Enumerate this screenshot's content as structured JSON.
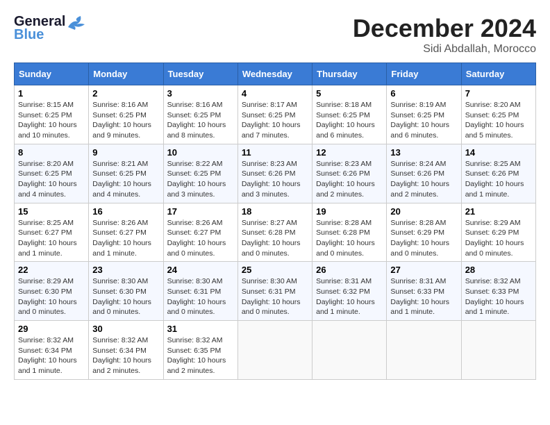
{
  "header": {
    "logo": {
      "general": "General",
      "blue": "Blue"
    },
    "title": "December 2024",
    "location": "Sidi Abdallah, Morocco"
  },
  "days_of_week": [
    "Sunday",
    "Monday",
    "Tuesday",
    "Wednesday",
    "Thursday",
    "Friday",
    "Saturday"
  ],
  "weeks": [
    [
      {
        "day": "1",
        "sunrise": "8:15 AM",
        "sunset": "6:25 PM",
        "daylight": "10 hours and 10 minutes."
      },
      {
        "day": "2",
        "sunrise": "8:16 AM",
        "sunset": "6:25 PM",
        "daylight": "10 hours and 9 minutes."
      },
      {
        "day": "3",
        "sunrise": "8:16 AM",
        "sunset": "6:25 PM",
        "daylight": "10 hours and 8 minutes."
      },
      {
        "day": "4",
        "sunrise": "8:17 AM",
        "sunset": "6:25 PM",
        "daylight": "10 hours and 7 minutes."
      },
      {
        "day": "5",
        "sunrise": "8:18 AM",
        "sunset": "6:25 PM",
        "daylight": "10 hours and 6 minutes."
      },
      {
        "day": "6",
        "sunrise": "8:19 AM",
        "sunset": "6:25 PM",
        "daylight": "10 hours and 6 minutes."
      },
      {
        "day": "7",
        "sunrise": "8:20 AM",
        "sunset": "6:25 PM",
        "daylight": "10 hours and 5 minutes."
      }
    ],
    [
      {
        "day": "8",
        "sunrise": "8:20 AM",
        "sunset": "6:25 PM",
        "daylight": "10 hours and 4 minutes."
      },
      {
        "day": "9",
        "sunrise": "8:21 AM",
        "sunset": "6:25 PM",
        "daylight": "10 hours and 4 minutes."
      },
      {
        "day": "10",
        "sunrise": "8:22 AM",
        "sunset": "6:25 PM",
        "daylight": "10 hours and 3 minutes."
      },
      {
        "day": "11",
        "sunrise": "8:23 AM",
        "sunset": "6:26 PM",
        "daylight": "10 hours and 3 minutes."
      },
      {
        "day": "12",
        "sunrise": "8:23 AM",
        "sunset": "6:26 PM",
        "daylight": "10 hours and 2 minutes."
      },
      {
        "day": "13",
        "sunrise": "8:24 AM",
        "sunset": "6:26 PM",
        "daylight": "10 hours and 2 minutes."
      },
      {
        "day": "14",
        "sunrise": "8:25 AM",
        "sunset": "6:26 PM",
        "daylight": "10 hours and 1 minute."
      }
    ],
    [
      {
        "day": "15",
        "sunrise": "8:25 AM",
        "sunset": "6:27 PM",
        "daylight": "10 hours and 1 minute."
      },
      {
        "day": "16",
        "sunrise": "8:26 AM",
        "sunset": "6:27 PM",
        "daylight": "10 hours and 1 minute."
      },
      {
        "day": "17",
        "sunrise": "8:26 AM",
        "sunset": "6:27 PM",
        "daylight": "10 hours and 0 minutes."
      },
      {
        "day": "18",
        "sunrise": "8:27 AM",
        "sunset": "6:28 PM",
        "daylight": "10 hours and 0 minutes."
      },
      {
        "day": "19",
        "sunrise": "8:28 AM",
        "sunset": "6:28 PM",
        "daylight": "10 hours and 0 minutes."
      },
      {
        "day": "20",
        "sunrise": "8:28 AM",
        "sunset": "6:29 PM",
        "daylight": "10 hours and 0 minutes."
      },
      {
        "day": "21",
        "sunrise": "8:29 AM",
        "sunset": "6:29 PM",
        "daylight": "10 hours and 0 minutes."
      }
    ],
    [
      {
        "day": "22",
        "sunrise": "8:29 AM",
        "sunset": "6:30 PM",
        "daylight": "10 hours and 0 minutes."
      },
      {
        "day": "23",
        "sunrise": "8:30 AM",
        "sunset": "6:30 PM",
        "daylight": "10 hours and 0 minutes."
      },
      {
        "day": "24",
        "sunrise": "8:30 AM",
        "sunset": "6:31 PM",
        "daylight": "10 hours and 0 minutes."
      },
      {
        "day": "25",
        "sunrise": "8:30 AM",
        "sunset": "6:31 PM",
        "daylight": "10 hours and 0 minutes."
      },
      {
        "day": "26",
        "sunrise": "8:31 AM",
        "sunset": "6:32 PM",
        "daylight": "10 hours and 1 minute."
      },
      {
        "day": "27",
        "sunrise": "8:31 AM",
        "sunset": "6:33 PM",
        "daylight": "10 hours and 1 minute."
      },
      {
        "day": "28",
        "sunrise": "8:32 AM",
        "sunset": "6:33 PM",
        "daylight": "10 hours and 1 minute."
      }
    ],
    [
      {
        "day": "29",
        "sunrise": "8:32 AM",
        "sunset": "6:34 PM",
        "daylight": "10 hours and 1 minute."
      },
      {
        "day": "30",
        "sunrise": "8:32 AM",
        "sunset": "6:34 PM",
        "daylight": "10 hours and 2 minutes."
      },
      {
        "day": "31",
        "sunrise": "8:32 AM",
        "sunset": "6:35 PM",
        "daylight": "10 hours and 2 minutes."
      },
      null,
      null,
      null,
      null
    ]
  ],
  "labels": {
    "sunrise": "Sunrise:",
    "sunset": "Sunset:",
    "daylight": "Daylight:"
  }
}
